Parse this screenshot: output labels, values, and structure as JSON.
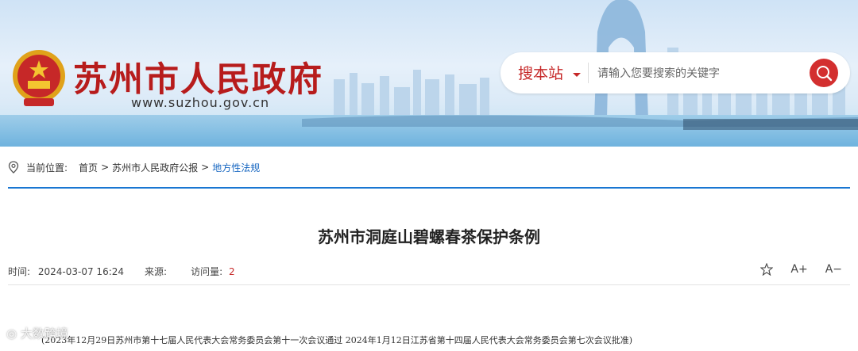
{
  "header": {
    "site_title": "苏州市人民政府",
    "site_url": "www.suzhou.gov.cn"
  },
  "search": {
    "scope_label": "搜本站",
    "placeholder": "请输入您要搜索的关键字"
  },
  "breadcrumb": {
    "label": "当前位置:",
    "items": [
      "首页",
      "苏州市人民政府公报",
      "地方性法规"
    ],
    "separator": ">"
  },
  "article": {
    "title": "苏州市洞庭山碧螺春茶保护条例",
    "meta": {
      "time_label": "时间:",
      "time_value": "2024-03-07 16:24",
      "source_label": "来源:",
      "source_value": "",
      "views_label": "访问量:",
      "views_value": "2"
    },
    "tools": {
      "font_increase": "A+",
      "font_decrease": "A−"
    },
    "lead": "(2023年12月29日苏州市第十七届人民代表大会常务委员会第十一次会议通过  2024年1月12日江苏省第十四届人民代表大会常务委员会第七次会议批准)"
  },
  "watermark": {
    "text": "大数跨境"
  },
  "colors": {
    "brand_red": "#b71c1c",
    "accent_blue": "#1976d2",
    "search_button": "#d32f2f"
  }
}
